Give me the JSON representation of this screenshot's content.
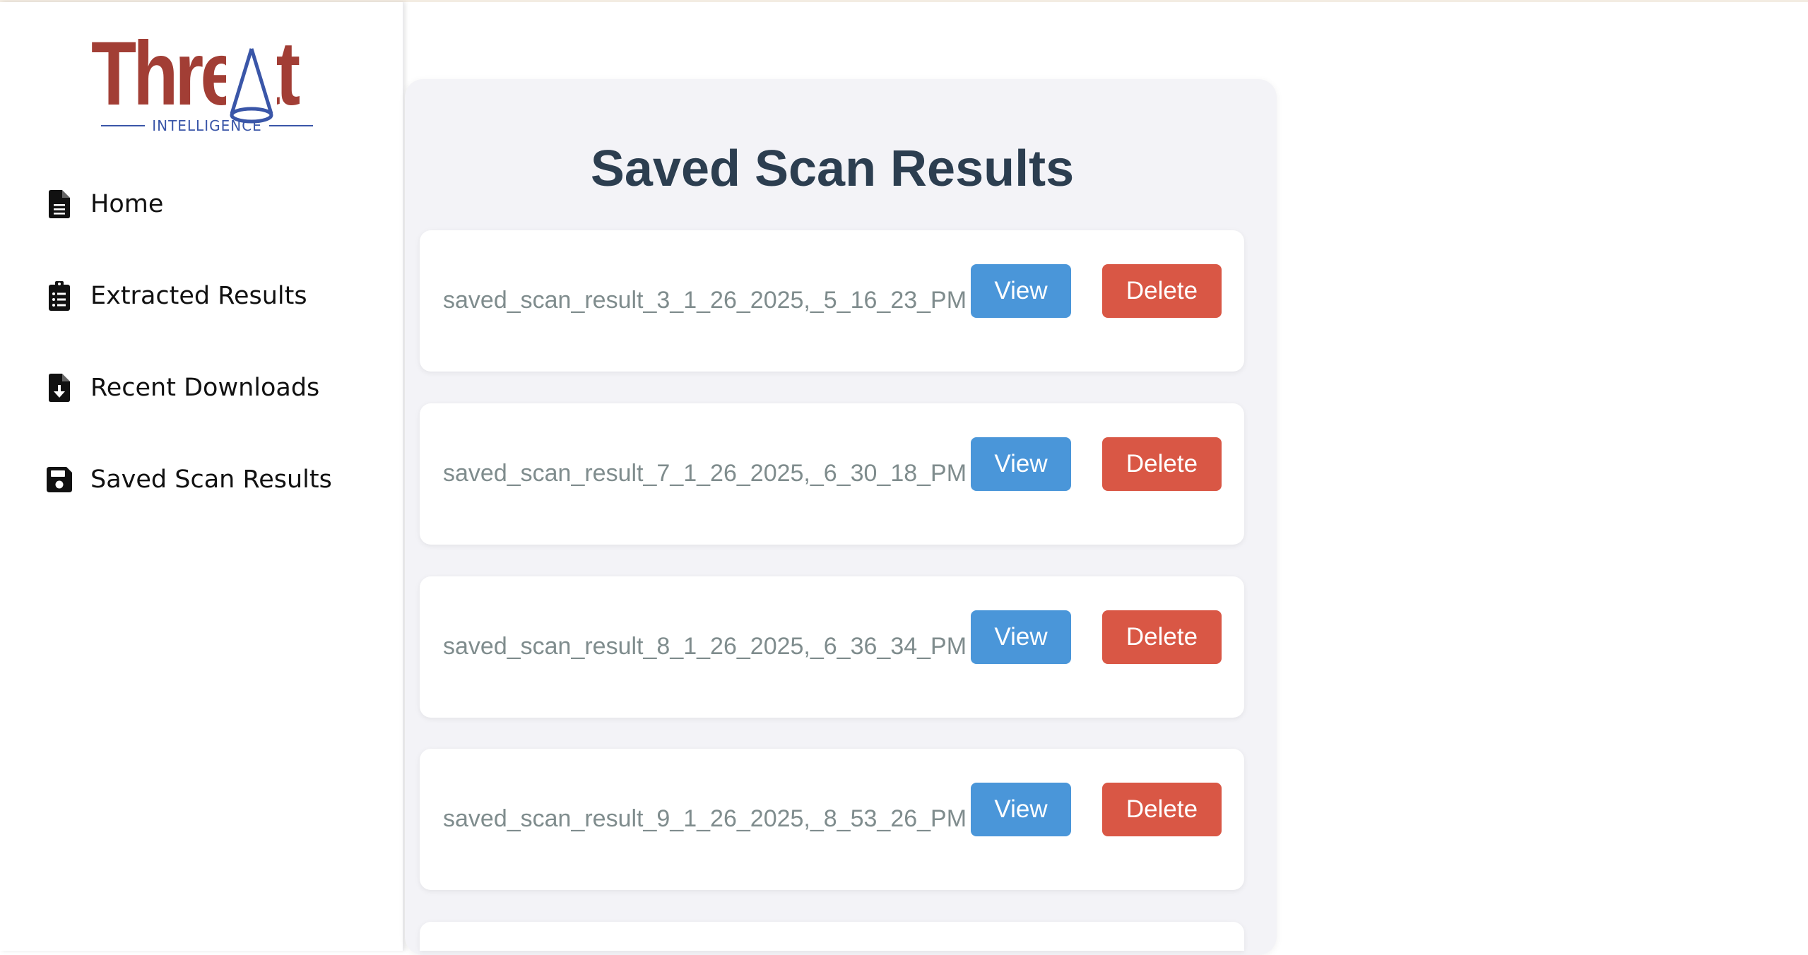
{
  "logo": {
    "word": "Threat",
    "subtitle": "INTELLIGENCE"
  },
  "sidebar": {
    "items": [
      {
        "label": "Home",
        "icon": "file-text-icon"
      },
      {
        "label": "Extracted Results",
        "icon": "clipboard-list-icon"
      },
      {
        "label": "Recent Downloads",
        "icon": "file-download-icon"
      },
      {
        "label": "Saved Scan Results",
        "icon": "floppy-disk-icon"
      }
    ]
  },
  "main": {
    "title": "Saved Scan Results",
    "results": [
      {
        "name": "saved_scan_result_3_1_26_2025,_5_16_23_PM",
        "view_label": "View",
        "delete_label": "Delete"
      },
      {
        "name": "saved_scan_result_7_1_26_2025,_6_30_18_PM",
        "view_label": "View",
        "delete_label": "Delete"
      },
      {
        "name": "saved_scan_result_8_1_26_2025,_6_36_34_PM",
        "view_label": "View",
        "delete_label": "Delete"
      },
      {
        "name": "saved_scan_result_9_1_26_2025,_8_53_26_PM",
        "view_label": "View",
        "delete_label": "Delete"
      }
    ]
  },
  "colors": {
    "brand_red": "#a23e35",
    "brand_blue": "#3a56a8",
    "view_button": "#4a96d9",
    "delete_button": "#d95745",
    "title": "#2c3e50"
  }
}
